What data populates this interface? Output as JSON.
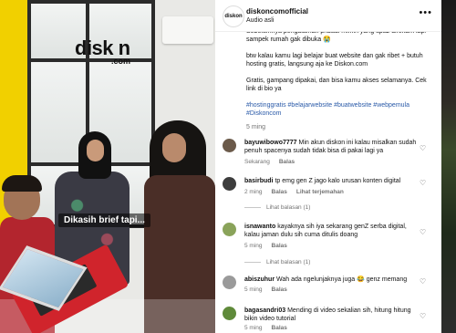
{
  "video": {
    "brand_logo": "disk n",
    "brand_logo_sub": ".com",
    "caption_text": "Dikasih brief tapi..."
  },
  "header": {
    "avatar_text": "diskon",
    "username": "diskoncomofficial",
    "audio": "Audio asli",
    "more": "•••"
  },
  "post_caption": {
    "para1": "Sebelumnya pengalaman pribadi mimin yang upaz direkam lapi sampek rumah gak dibuka 😭",
    "para2": "btw kalau kamu lagi belajar buat website dan gak ribet + butuh hosting gratis, langsung aja ke Diskon.com",
    "para3": "Gratis, gampang dipakai, dan bisa kamu akses selamanya. Cek link di bio ya",
    "hashtags": "#hostinggratis #belajarwebsite #buatwebsite #webpemula #Diskoncom",
    "time": "5 ming"
  },
  "comments": [
    {
      "username": "bayuwibowo7777",
      "text": "Min akun diskon ini kalau misalkan sudah penuh spacenya sudah tidak bisa di pakai lagi ya",
      "time": "Sekarang",
      "reply_label": "Balas",
      "avatar_color": "#6b5a4a"
    },
    {
      "username": "basirbudi",
      "text": "tp emg gen Z jago kalo urusan konten digital",
      "time": "2 ming",
      "reply_label": "Balas",
      "translate_label": "Lihat terjemahan",
      "replies_label": "Lihat balasan (1)",
      "avatar_color": "#3d3d3d"
    },
    {
      "username": "isnawanto",
      "text": "kayaknya sih iya sekarang genZ serba digital, kalau jaman dulu sih cuma ditulis doang",
      "time": "5 ming",
      "reply_label": "Balas",
      "replies_label": "Lihat balasan (1)",
      "avatar_color": "#8aa35a"
    },
    {
      "username": "abiszuhur",
      "text": "Wah ada ngelunjaknya juga 😂 genz memang",
      "time": "5 ming",
      "reply_label": "Balas",
      "avatar_color": "#9a9a9a"
    },
    {
      "username": "bagasandri03",
      "text": "Mending di video sekalian sih, hitung hitung bikin video tutorial",
      "time": "5 ming",
      "reply_label": "Balas",
      "avatar_color": "#5f8a3a"
    }
  ]
}
